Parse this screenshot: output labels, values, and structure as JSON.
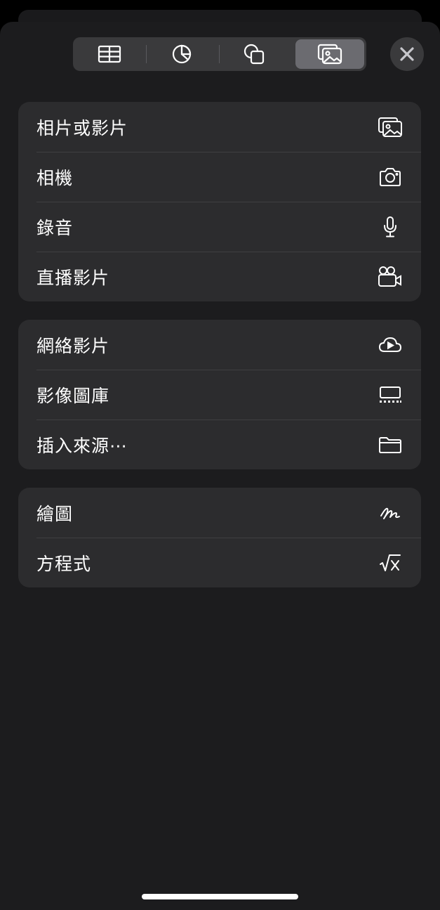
{
  "toolbar": {
    "segments": [
      {
        "icon": "table-icon",
        "active": false
      },
      {
        "icon": "chart-icon",
        "active": false
      },
      {
        "icon": "shapes-icon",
        "active": false
      },
      {
        "icon": "media-icon",
        "active": true
      }
    ],
    "close_icon": "close-icon"
  },
  "groups": [
    {
      "items": [
        {
          "label": "相片或影片",
          "icon": "photo-icon"
        },
        {
          "label": "相機",
          "icon": "camera-icon"
        },
        {
          "label": "錄音",
          "icon": "microphone-icon"
        },
        {
          "label": "直播影片",
          "icon": "video-camera-icon"
        }
      ]
    },
    {
      "items": [
        {
          "label": "網絡影片",
          "icon": "cloud-play-icon"
        },
        {
          "label": "影像圖庫",
          "icon": "image-gallery-icon"
        },
        {
          "label": "插入來源⋯",
          "icon": "folder-icon"
        }
      ]
    },
    {
      "items": [
        {
          "label": "繪圖",
          "icon": "scribble-icon"
        },
        {
          "label": "方程式",
          "icon": "equation-icon"
        }
      ]
    }
  ],
  "colors": {
    "background": "#000000",
    "sheet": "#1c1c1e",
    "group": "#2c2c2e",
    "segment_active": "#6b6b70",
    "text": "#ffffff"
  }
}
